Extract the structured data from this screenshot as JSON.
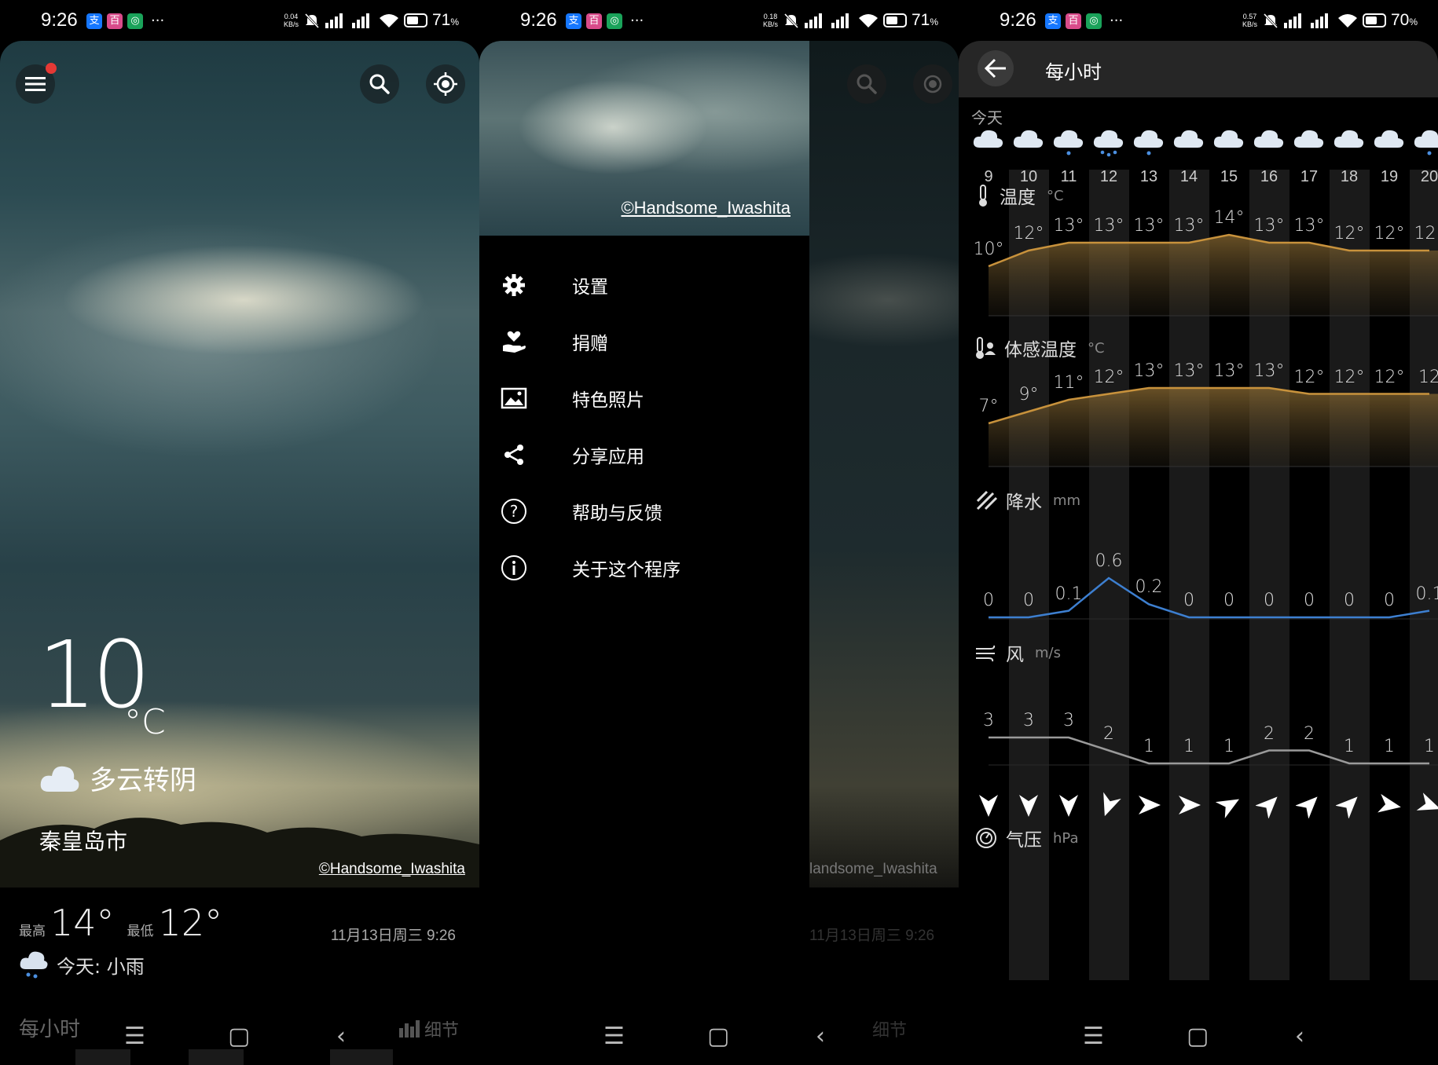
{
  "status_bars": [
    {
      "time": "9:26",
      "speed_top": "0.04",
      "speed_bottom": "KB/s",
      "battery": "71",
      "battery_pct": "%",
      "battery_level": 0.71
    },
    {
      "time": "9:26",
      "speed_top": "0.18",
      "speed_bottom": "KB/s",
      "battery": "71",
      "battery_pct": "%",
      "battery_level": 0.71
    },
    {
      "time": "9:26",
      "speed_top": "0.57",
      "speed_bottom": "KB/s",
      "battery": "70",
      "battery_pct": "%",
      "battery_level": 0.7
    }
  ],
  "status_app_icons": [
    "支",
    "百",
    "◎"
  ],
  "main": {
    "temperature": "10",
    "temp_unit": "°C",
    "condition": "多云转阴",
    "city": "秦皇岛市",
    "photo_credit": "©Handsome_Iwashita",
    "high_label": "最高",
    "high": "14°",
    "low_label": "最低",
    "low": "12°",
    "datetime": "11月13日周三 9:26",
    "today_forecast": "今天: 小雨",
    "hourly_tab": "每小时",
    "details_tab": "细节"
  },
  "drawer": {
    "photo_credit": "©Handsome_Iwashita",
    "items": [
      {
        "label": "设置",
        "icon": "gear-icon"
      },
      {
        "label": "捐赠",
        "icon": "donate-hand-heart-icon"
      },
      {
        "label": "特色照片",
        "icon": "image-icon"
      },
      {
        "label": "分享应用",
        "icon": "share-icon"
      },
      {
        "label": "帮助与反馈",
        "icon": "help-circle-icon"
      },
      {
        "label": "关于这个程序",
        "icon": "info-circle-icon"
      }
    ],
    "scrim_credit": "landsome_Iwashita",
    "scrim_datetime": "11月13日周三 9:26",
    "scrim_details": "细节"
  },
  "hourly": {
    "title": "每小时",
    "today_label": "今天",
    "hours": [
      "9",
      "10",
      "11",
      "12",
      "13",
      "14",
      "15",
      "16",
      "17",
      "18",
      "19",
      "20"
    ],
    "weather_icons": [
      "cloud",
      "cloud",
      "cloud-drizzle",
      "cloud-rain",
      "cloud-drizzle",
      "cloud",
      "cloud",
      "cloud",
      "cloud",
      "cloud",
      "cloud",
      "cloud-drizzle"
    ],
    "sections": {
      "temperature": {
        "label": "温度",
        "unit": "°C"
      },
      "feels_like": {
        "label": "体感温度",
        "unit": "°C"
      },
      "precipitation": {
        "label": "降水",
        "unit": "mm"
      },
      "wind": {
        "label": "风",
        "unit": "m/s"
      },
      "pressure": {
        "label": "气压",
        "unit": "hPa"
      }
    },
    "wind_direction_deg": [
      180,
      180,
      180,
      200,
      90,
      90,
      60,
      45,
      45,
      45,
      100,
      110
    ]
  },
  "chart_data": [
    {
      "type": "line",
      "title": "温度",
      "ylabel": "°C",
      "x": [
        "9",
        "10",
        "11",
        "12",
        "13",
        "14",
        "15",
        "16",
        "17",
        "18",
        "19",
        "20"
      ],
      "series": [
        {
          "values": [
            10,
            12,
            13,
            13,
            13,
            13,
            14,
            13,
            13,
            12,
            12,
            12
          ]
        }
      ],
      "labels": [
        "10°",
        "12°",
        "13°",
        "13°",
        "13°",
        "13°",
        "14°",
        "13°",
        "13°",
        "12°",
        "12°",
        "12°"
      ]
    },
    {
      "type": "line",
      "title": "体感温度",
      "ylabel": "°C",
      "x": [
        "9",
        "10",
        "11",
        "12",
        "13",
        "14",
        "15",
        "16",
        "17",
        "18",
        "19",
        "20"
      ],
      "series": [
        {
          "values": [
            7,
            9,
            11,
            12,
            13,
            13,
            13,
            13,
            12,
            12,
            12,
            12
          ]
        }
      ],
      "labels": [
        "7°",
        "9°",
        "11°",
        "12°",
        "13°",
        "13°",
        "13°",
        "13°",
        "12°",
        "12°",
        "12°",
        "12"
      ]
    },
    {
      "type": "line",
      "title": "降水",
      "ylabel": "mm",
      "x": [
        "9",
        "10",
        "11",
        "12",
        "13",
        "14",
        "15",
        "16",
        "17",
        "18",
        "19",
        "20"
      ],
      "series": [
        {
          "values": [
            0,
            0,
            0.1,
            0.6,
            0.2,
            0,
            0,
            0,
            0,
            0,
            0,
            0.1
          ]
        }
      ],
      "labels": [
        "0",
        "0",
        "0.1",
        "0.6",
        "0.2",
        "0",
        "0",
        "0",
        "0",
        "0",
        "0",
        "0.1"
      ]
    },
    {
      "type": "line",
      "title": "风",
      "ylabel": "m/s",
      "x": [
        "9",
        "10",
        "11",
        "12",
        "13",
        "14",
        "15",
        "16",
        "17",
        "18",
        "19",
        "20"
      ],
      "series": [
        {
          "values": [
            3,
            3,
            3,
            2,
            1,
            1,
            1,
            2,
            2,
            1,
            1,
            1
          ]
        }
      ],
      "labels": [
        "3",
        "3",
        "3",
        "2",
        "1",
        "1",
        "1",
        "2",
        "2",
        "1",
        "1",
        "1"
      ]
    }
  ],
  "colors": {
    "temp_line": "#c8923c",
    "precip_line": "#3d7fd0",
    "wind_line": "#9a9a9a",
    "stripe": "#1a1a1a",
    "red_dot": "#e53935"
  }
}
